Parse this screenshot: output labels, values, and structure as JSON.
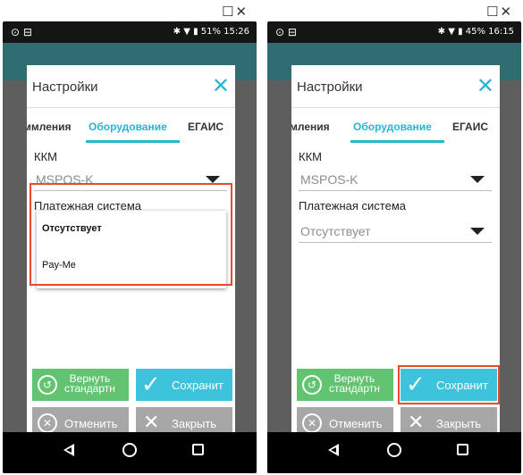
{
  "window_controls": "☐✕",
  "phones": [
    {
      "status_left": "⊙ ⊟",
      "status_right": "✱ ▼ ▮ 51% 15:26",
      "dialog_title": "Настройки",
      "close_symbol": "✕",
      "tabs": [
        "ммления",
        "Оборудование",
        "ЕГАИС"
      ],
      "field1_label": "ККМ",
      "field1_value": "MSPOS-K",
      "field2_label": "Платежная система",
      "popup_options": [
        "Отсутствует",
        "Pay-Me"
      ],
      "btn_reset": [
        "Вернуть",
        "стандартн"
      ],
      "btn_save": "Сохранит",
      "btn_cancel": "Отменить",
      "btn_close": "Закрыть"
    },
    {
      "status_left": "⊙ ⊟",
      "status_right": "✱ ▼ ▮ 45% 16:15",
      "dialog_title": "Настройки",
      "close_symbol": "✕",
      "tabs": [
        "мления",
        "Оборудование",
        "ЕГАИС"
      ],
      "field1_label": "ККМ",
      "field1_value": "MSPOS-K",
      "field2_label": "Платежная система",
      "field2_value": "Отсутствует",
      "btn_reset": [
        "Вернуть",
        "стандартн"
      ],
      "btn_save": "Сохранит",
      "btn_cancel": "Отменить",
      "btn_close": "Закрыть"
    }
  ],
  "colors": {
    "accent": "#29b4d2",
    "button_green": "#62c471",
    "button_cyan": "#3dc3db",
    "button_gray": "#a7a7a7",
    "highlight_red": "#e54b2d",
    "dim_backdrop": "#5e5e5e"
  }
}
